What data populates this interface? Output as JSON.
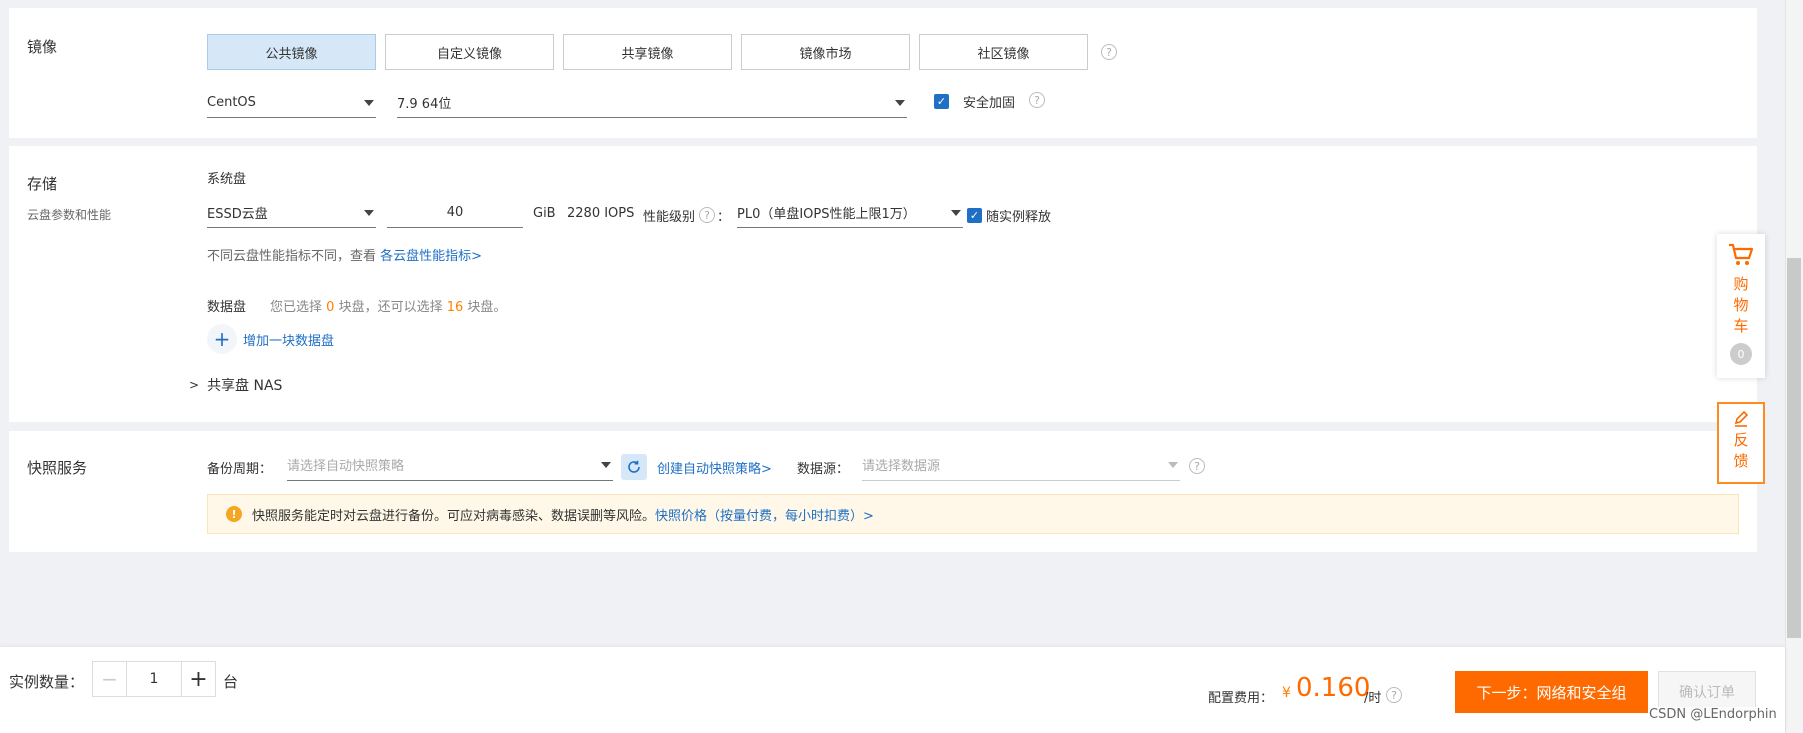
{
  "image": {
    "label": "镜像",
    "tabs": [
      "公共镜像",
      "自定义镜像",
      "共享镜像",
      "镜像市场",
      "社区镜像"
    ],
    "active_tab": 0,
    "os_value": "CentOS",
    "version_value": "7.9 64位",
    "security_label": "安全加固",
    "security_checked": true
  },
  "storage": {
    "label": "存储",
    "sublabel": "云盘参数和性能",
    "system_disk_label": "系统盘",
    "disk_type": "ESSD云盘",
    "disk_size": "40",
    "unit": "GiB",
    "iops": "2280 IOPS",
    "perf_label": "性能级别",
    "perf_colon": "：",
    "perf_value": "PL0（单盘IOPS性能上限1万）",
    "release_label": "随实例释放",
    "note_prefix": "不同云盘性能指标不同，查看",
    "note_link": "各云盘性能指标>",
    "data_disk_label": "数据盘",
    "data_disk_info_a": "您已选择",
    "data_disk_selected": "0",
    "data_disk_info_b": "块盘，还可以选择",
    "data_disk_remaining": "16",
    "data_disk_info_c": "块盘。",
    "add_disk_label": "增加一块数据盘",
    "nas_label": "共享盘 NAS"
  },
  "snapshot": {
    "label": "快照服务",
    "period_label": "备份周期：",
    "period_placeholder": "请选择自动快照策略",
    "create_link": "创建自动快照策略>",
    "source_label": "数据源：",
    "source_placeholder": "请选择数据源",
    "notice_text": "快照服务能定时对云盘进行备份。可应对病毒感染、数据误删等风险。",
    "notice_link": "快照价格（按量付费，每小时扣费）>"
  },
  "side": {
    "cart_label": "购物车",
    "cart_count": "0",
    "feedback_label": "反馈"
  },
  "footer": {
    "quantity_label": "实例数量：",
    "quantity_value": "1",
    "quantity_unit": "台",
    "fee_label": "配置费用：",
    "currency": "¥",
    "fee_value": "0.160",
    "fee_unit": "/时",
    "next_button": "下一步：网络和安全组",
    "confirm_button": "确认订单",
    "watermark": "CSDN @LEndorphin"
  },
  "colors": {
    "accent": "#1f6fc4",
    "primary_button": "#ff6a00",
    "orange_text": "#ff8000"
  }
}
